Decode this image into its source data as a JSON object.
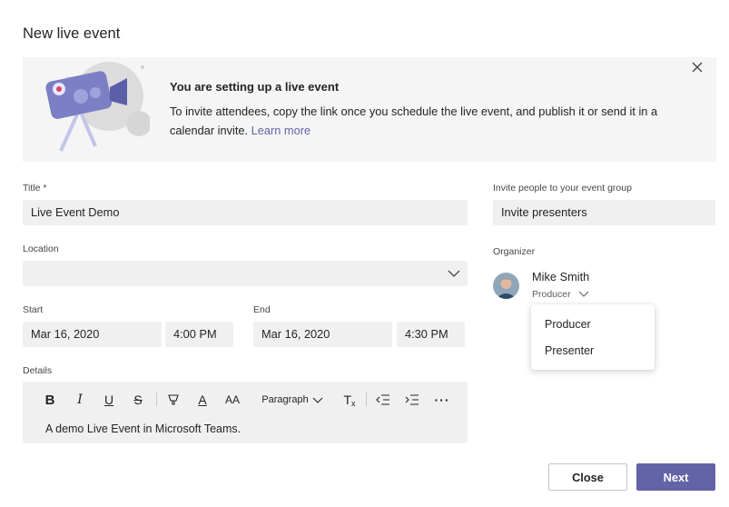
{
  "dialog": {
    "title": "New live event"
  },
  "banner": {
    "title": "You are setting up a live event",
    "text": "To invite attendees, copy the link once you schedule the live event, and publish it or send it in a calendar invite.",
    "link": "Learn more"
  },
  "form": {
    "title_label": "Title *",
    "title_value": "Live Event Demo",
    "location_label": "Location",
    "location_value": "",
    "start_label": "Start",
    "start_date": "Mar 16, 2020",
    "start_time": "4:00 PM",
    "end_label": "End",
    "end_date": "Mar 16, 2020",
    "end_time": "4:30 PM",
    "details_label": "Details",
    "details_text": "A demo Live Event in Microsoft Teams.",
    "paragraph_style": "Paragraph"
  },
  "invite": {
    "label": "Invite people to your event group",
    "placeholder": "Invite presenters"
  },
  "organizer": {
    "label": "Organizer",
    "name": "Mike Smith",
    "role": "Producer"
  },
  "role_menu": {
    "options": [
      "Producer",
      "Presenter"
    ]
  },
  "buttons": {
    "close": "Close",
    "next": "Next"
  },
  "colors": {
    "accent": "#6264a7",
    "field_bg": "#f0f0f0",
    "banner_bg": "#f5f5f5"
  }
}
